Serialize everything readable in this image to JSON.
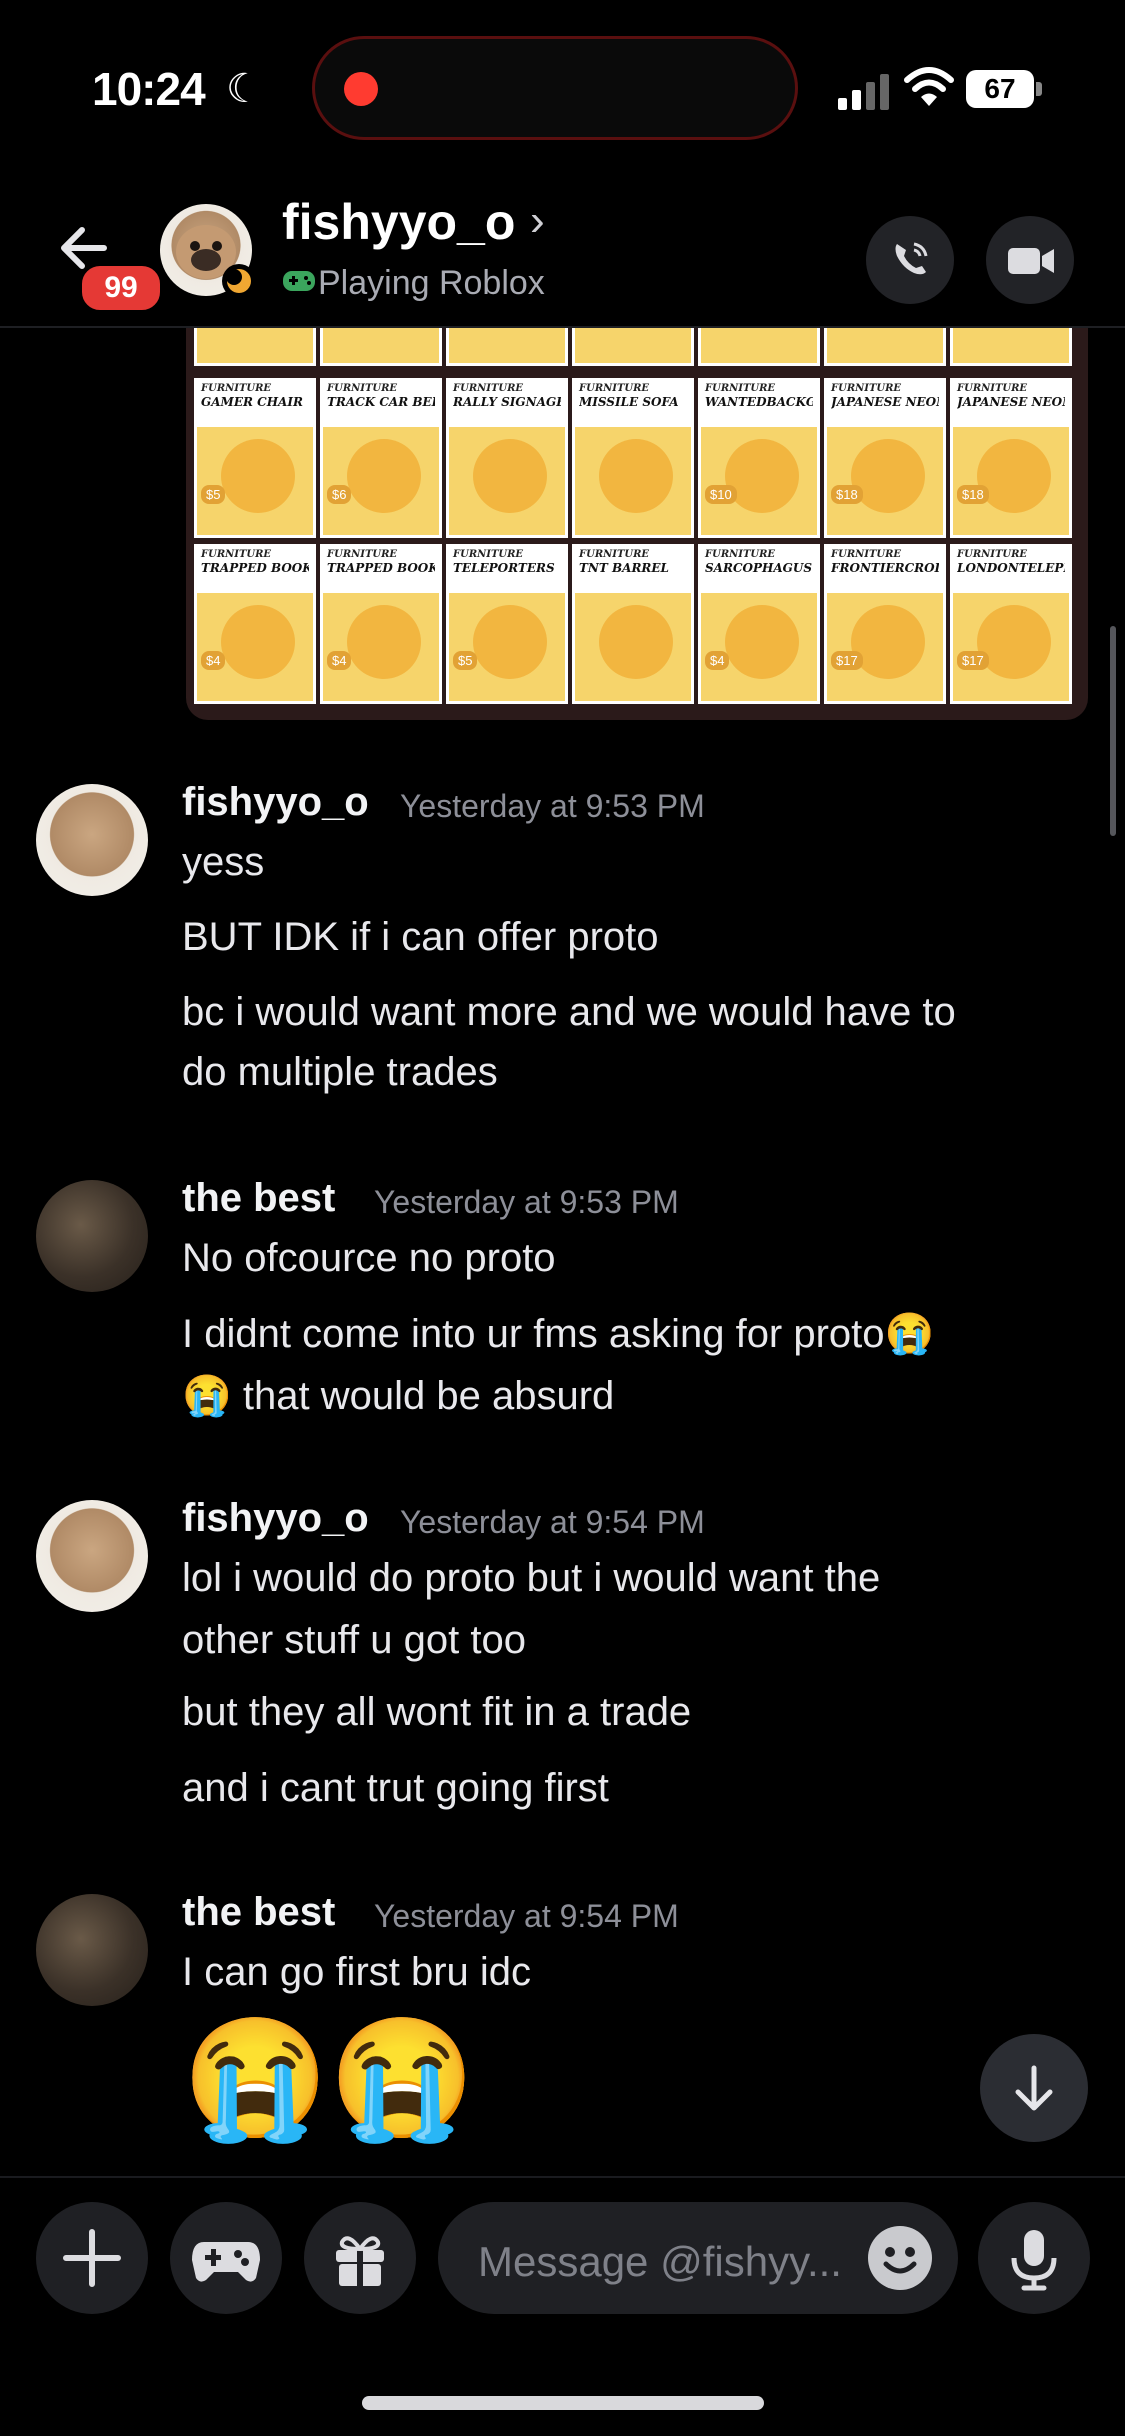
{
  "status_bar": {
    "time": "10:24",
    "battery": "67"
  },
  "header": {
    "unread_badge": "99",
    "username": "fishyyo_o",
    "activity": "Playing Roblox"
  },
  "shared_image": {
    "row1": [
      {
        "category": "FURNITURE",
        "name": "GAMER CHAIR",
        "price": "$5"
      },
      {
        "category": "FURNITURE",
        "name": "TRACK CAR BED",
        "price": "$6"
      },
      {
        "category": "FURNITURE",
        "name": "RALLY SIGNAGE",
        "price": ""
      },
      {
        "category": "FURNITURE",
        "name": "MISSILE SOFA",
        "price": ""
      },
      {
        "category": "FURNITURE",
        "name": "WANTEDBACKGROUND",
        "price": "$10"
      },
      {
        "category": "FURNITURE",
        "name": "JAPANESE NEON SIGN",
        "price": "$18"
      },
      {
        "category": "FURNITURE",
        "name": "JAPANESE NEON SIGN",
        "price": "$18"
      }
    ],
    "row2": [
      {
        "category": "FURNITURE",
        "name": "TRAPPED BOOKSHELF",
        "price": "$4"
      },
      {
        "category": "FURNITURE",
        "name": "TRAPPED BOOKSHELF",
        "price": "$4"
      },
      {
        "category": "FURNITURE",
        "name": "TELEPORTERS",
        "price": "$5"
      },
      {
        "category": "FURNITURE",
        "name": "TNT BARREL",
        "price": ""
      },
      {
        "category": "FURNITURE",
        "name": "SARCOPHAGUS BED",
        "price": "$4"
      },
      {
        "category": "FURNITURE",
        "name": "FRONTIERCROISSANTSOFA",
        "price": "$17"
      },
      {
        "category": "FURNITURE",
        "name": "LONDONTELEPHONESOFA",
        "price": "$17"
      }
    ]
  },
  "messages": [
    {
      "author": "fishyyo_o",
      "timestamp": "Yesterday at 9:53 PM",
      "lines": [
        "yess",
        "BUT IDK if i can offer proto",
        "bc i would want more and we would have to",
        "do multiple trades"
      ]
    },
    {
      "author": "the best",
      "timestamp": "Yesterday at 9:53 PM",
      "lines": [
        "No ofcource no proto",
        "I didnt come into ur fms asking for proto😭",
        "😭 that would be absurd"
      ]
    },
    {
      "author": "fishyyo_o",
      "timestamp": "Yesterday at 9:54 PM",
      "lines": [
        "lol i would do proto but i would want the",
        "other stuff u got too",
        "but they all wont fit in a trade",
        "and i cant trut going first"
      ]
    },
    {
      "author": "the best",
      "timestamp": "Yesterday at 9:54 PM",
      "lines": [
        "I can go first bru idc",
        "😭😭"
      ]
    }
  ],
  "composer": {
    "placeholder": "Message @fishyy..."
  },
  "icons": {
    "back": "arrow-left-icon",
    "call": "phone-icon",
    "video": "video-camera-icon",
    "add": "plus-icon",
    "games": "gamepad-icon",
    "gift": "gift-icon",
    "emoji": "smiley-icon",
    "mic": "microphone-icon",
    "jump": "arrow-down-icon"
  },
  "colors": {
    "badge": "#e53935",
    "background": "#000000",
    "activity_icon": "#3ba55d"
  }
}
